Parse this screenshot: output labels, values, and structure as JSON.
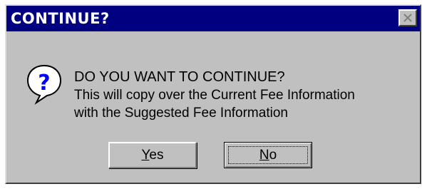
{
  "dialog": {
    "title": "CONTINUE?",
    "icon": "question-icon",
    "heading": "DO YOU WANT TO CONTINUE?",
    "body_line1": "This will copy over the Current Fee Information",
    "body_line2": "with the Suggested Fee Information"
  },
  "buttons": {
    "yes_accel": "Y",
    "yes_rest": "es",
    "no_accel": "N",
    "no_rest": "o"
  },
  "colors": {
    "titlebar": "#000080",
    "face": "#c0c0c0",
    "icon_blue": "#0000ff"
  }
}
